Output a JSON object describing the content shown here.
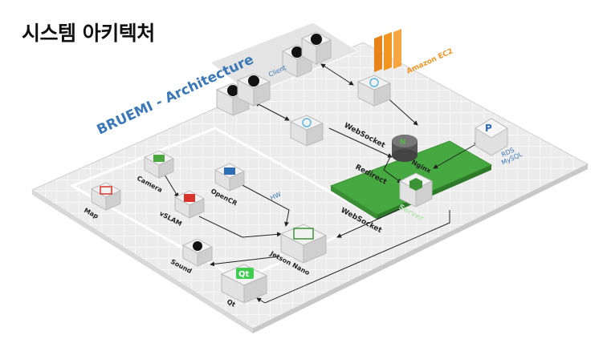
{
  "title": "시스템 아키텍처",
  "diagram_title": "BRUEMI - Architecture",
  "zones": {
    "client": "Client",
    "hw": "HW",
    "server": "Server",
    "ec2": "Amazon EC2"
  },
  "nodes": {
    "camera": "Camera",
    "opencr": "OpenCR",
    "map": "Map",
    "vslam": "vSLAM",
    "jetson": "Jetson Nano",
    "sound": "Sound",
    "qt": "Qt",
    "nginx": "Nginx",
    "rds": "RDS\nMySQL"
  },
  "edges": {
    "websocket_top": "WebSocket",
    "websocket_mid": "WebSocket",
    "redirect": "Redirect"
  },
  "colors": {
    "title_blue": "#3a78b7",
    "server_green": "#46a840",
    "ec2_orange": "#f29420",
    "grid_bg": "#ececec",
    "grid_line": "#ffffff"
  }
}
